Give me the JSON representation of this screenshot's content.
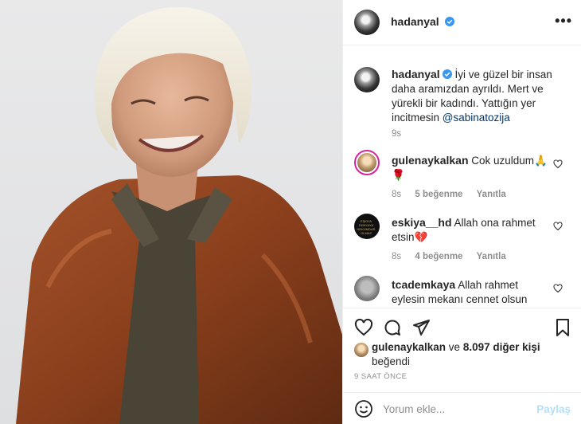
{
  "post": {
    "author": "hadanyal",
    "more_label": "•••"
  },
  "caption": {
    "username": "hadanyal",
    "text_lines": [
      "İyi ve güzel bir insan",
      "daha aramızdan ayrıldı. Mert ve",
      "yürekli bir kadındı. Yattığın yer",
      "incitmesin "
    ],
    "mention": "@sabinatozija",
    "time": "9s"
  },
  "comments": [
    {
      "username": "gulenaykalkan",
      "text_line1": "Cok uzuldum🙏",
      "text_line2": "🌹",
      "time": "8s",
      "likes": "5 beğenme",
      "reply": "Yanıtla"
    },
    {
      "username": "eskiya__hd",
      "text_line1": "Allah ona rahmet",
      "text_line2": "etsin💔",
      "time": "8s",
      "likes": "4 beğenme",
      "reply": "Yanıtla",
      "avatar_text": "EŞKIYA DÜNYAYA HÜKÜMDAR OLMAZ"
    },
    {
      "username": "tcademkaya",
      "text_line1": "Allah rahmet",
      "text_line2": "eylesin mekanı cennet olsun"
    }
  ],
  "likes": {
    "liker": "gulenaykalkan",
    "connector": " ve ",
    "others": "8.097 diğer kişi",
    "suffix": "beğendi"
  },
  "time_ago": "9 SAAT ÖNCE",
  "add_comment": {
    "placeholder": "Yorum ekle...",
    "post_label": "Paylaş"
  },
  "colors": {
    "text": "#262626",
    "muted": "#8e8e8e",
    "verified": "#3897f0",
    "link": "#00376b",
    "post_disabled": "#b2dffc"
  },
  "icons": [
    "verified-badge-icon",
    "more-options-icon",
    "heart-icon",
    "comment-icon",
    "share-icon",
    "bookmark-icon",
    "emoji-icon"
  ]
}
